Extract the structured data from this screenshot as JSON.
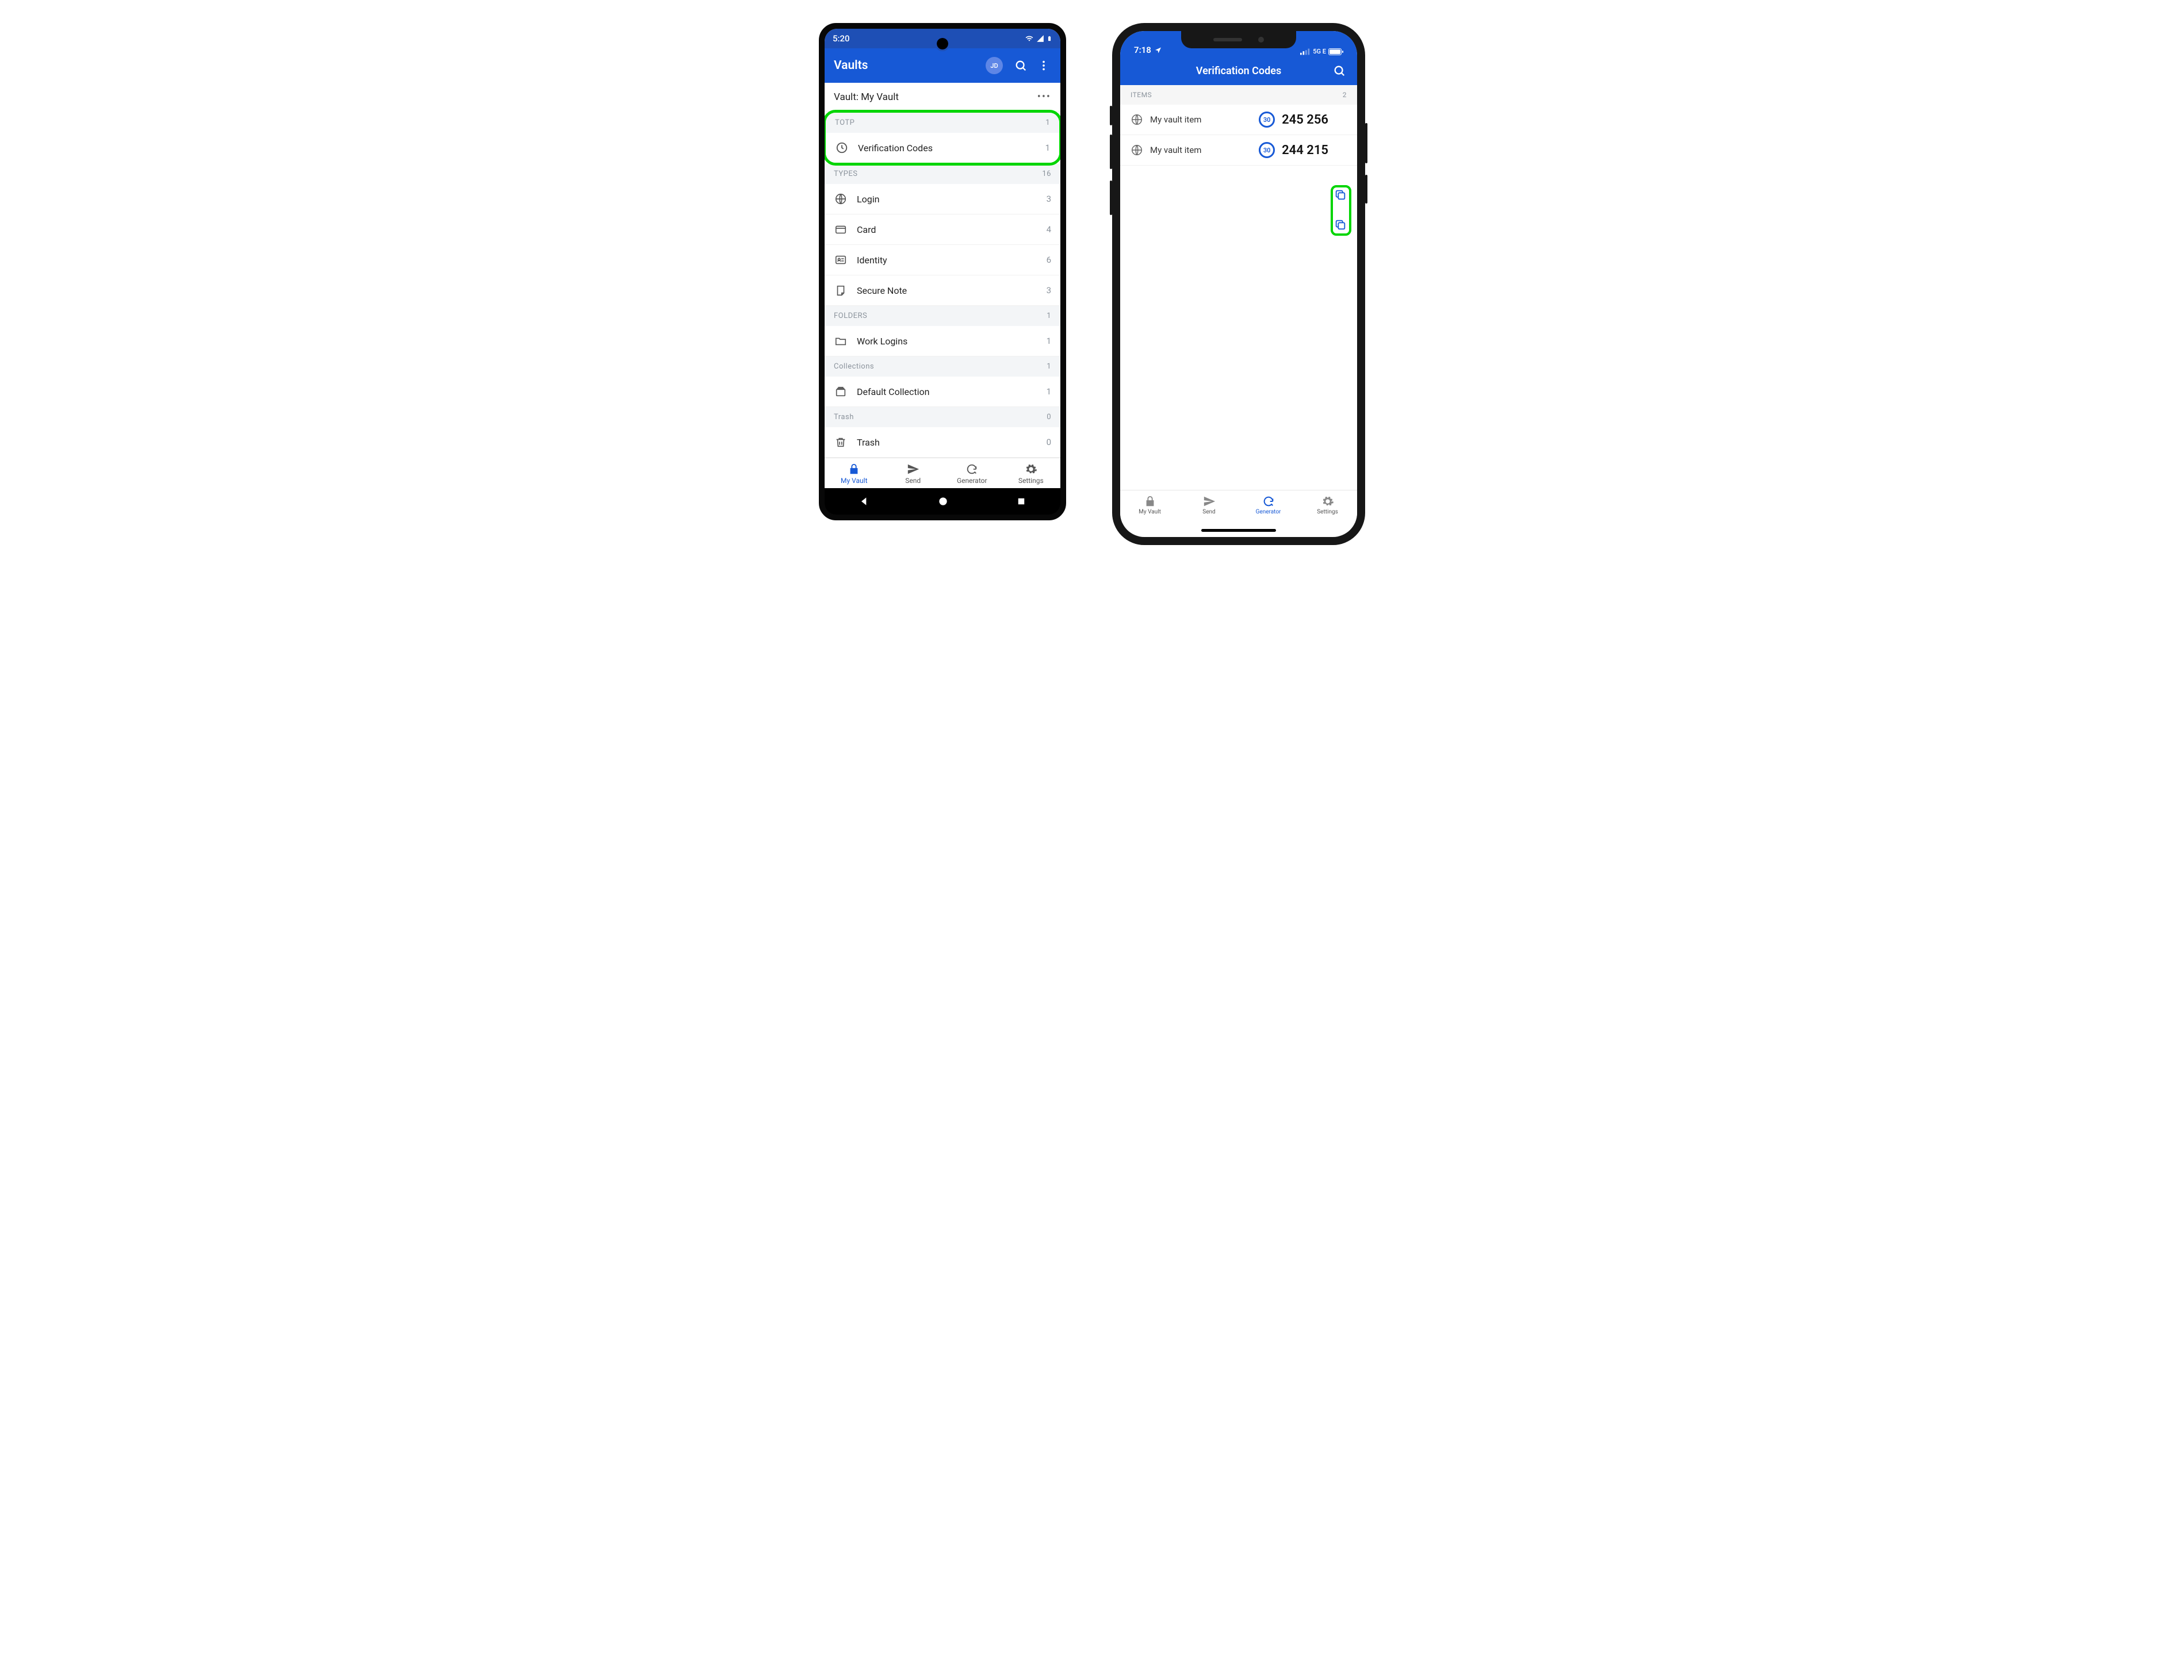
{
  "android": {
    "status": {
      "time": "5:20"
    },
    "appbar": {
      "title": "Vaults",
      "avatar_initials": "JD"
    },
    "vault_header": {
      "label": "Vault: My Vault"
    },
    "sections": {
      "totp": {
        "label": "TOTP",
        "count": "1"
      },
      "types": {
        "label": "TYPES",
        "count": "16"
      },
      "folders": {
        "label": "FOLDERS",
        "count": "1"
      },
      "collections": {
        "label": "Collections",
        "count": "1"
      },
      "trash": {
        "label": "Trash",
        "count": "0"
      }
    },
    "rows": {
      "verification_codes": {
        "label": "Verification Codes",
        "count": "1"
      },
      "login": {
        "label": "Login",
        "count": "3"
      },
      "card": {
        "label": "Card",
        "count": "4"
      },
      "identity": {
        "label": "Identity",
        "count": "6"
      },
      "secure_note": {
        "label": "Secure Note",
        "count": "3"
      },
      "work_logins": {
        "label": "Work Logins",
        "count": "1"
      },
      "default_collection": {
        "label": "Default Collection",
        "count": "1"
      },
      "trash": {
        "label": "Trash",
        "count": "0"
      }
    },
    "tabs": {
      "my_vault": "My Vault",
      "send": "Send",
      "generator": "Generator",
      "settings": "Settings"
    }
  },
  "ios": {
    "status": {
      "time": "7:18",
      "network": "5G E"
    },
    "appbar": {
      "title": "Verification Codes"
    },
    "section": {
      "label": "ITEMS",
      "count": "2"
    },
    "items": [
      {
        "name": "My vault item",
        "countdown": "30",
        "code": "245 256"
      },
      {
        "name": "My vault item",
        "countdown": "30",
        "code": "244 215"
      }
    ],
    "tabs": {
      "my_vault": "My Vault",
      "send": "Send",
      "generator": "Generator",
      "settings": "Settings"
    }
  }
}
